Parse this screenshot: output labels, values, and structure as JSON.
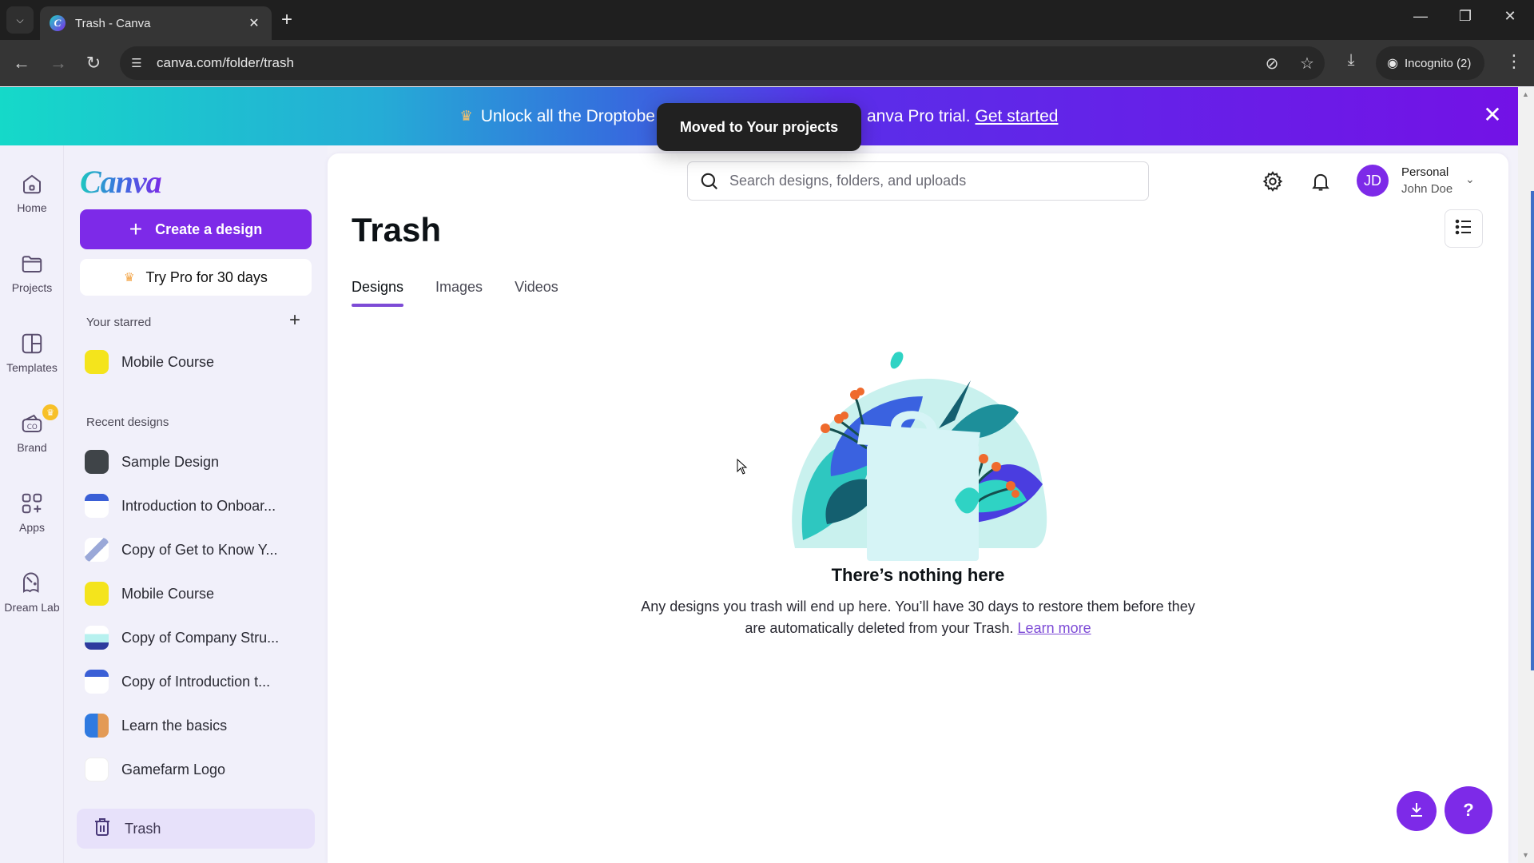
{
  "browser": {
    "tab_title": "Trash - Canva",
    "url": "canva.com/folder/trash",
    "incognito_label": "Incognito (2)"
  },
  "banner": {
    "text_before": "Unlock all the Droptobe",
    "text_after": "anva Pro trial.",
    "link": "Get started"
  },
  "toast": {
    "message": "Moved to Your projects"
  },
  "rail": {
    "items": [
      {
        "label": "Home",
        "icon": "home-icon"
      },
      {
        "label": "Projects",
        "icon": "folder-icon"
      },
      {
        "label": "Templates",
        "icon": "templates-icon"
      },
      {
        "label": "Brand",
        "icon": "brand-icon"
      },
      {
        "label": "Apps",
        "icon": "apps-icon"
      },
      {
        "label": "Dream Lab",
        "icon": "dream-lab-icon"
      }
    ]
  },
  "sidebar": {
    "logo": "Canva",
    "create_label": "Create a design",
    "pro_label": "Try Pro for 30 days",
    "starred_label": "Your starred",
    "starred": [
      {
        "label": "Mobile Course"
      }
    ],
    "recent_label": "Recent designs",
    "recent": [
      {
        "label": "Sample Design"
      },
      {
        "label": "Introduction to Onboar..."
      },
      {
        "label": "Copy of Get to Know Y..."
      },
      {
        "label": "Mobile Course"
      },
      {
        "label": "Copy of Company Stru..."
      },
      {
        "label": "Copy of Introduction t..."
      },
      {
        "label": "Learn the basics"
      },
      {
        "label": "Gamefarm Logo"
      }
    ],
    "trash_label": "Trash"
  },
  "header": {
    "search_placeholder": "Search designs, folders, and uploads",
    "avatar_initials": "JD",
    "account_type": "Personal",
    "account_name": "John Doe"
  },
  "main": {
    "title": "Trash",
    "tabs": [
      {
        "label": "Designs",
        "active": true
      },
      {
        "label": "Images",
        "active": false
      },
      {
        "label": "Videos",
        "active": false
      }
    ],
    "empty_title": "There’s nothing here",
    "empty_desc_1": "Any designs you trash will end up here. You’ll have 30 days to restore them before they",
    "empty_desc_2": "are automatically deleted from your Trash.",
    "learn_more": "Learn more"
  },
  "fabs": {
    "help_label": "?"
  },
  "colors": {
    "brand_purple": "#7d2ae8",
    "tab_underline": "#7d4bd6",
    "sidebar_bg": "#f1f0fa"
  }
}
